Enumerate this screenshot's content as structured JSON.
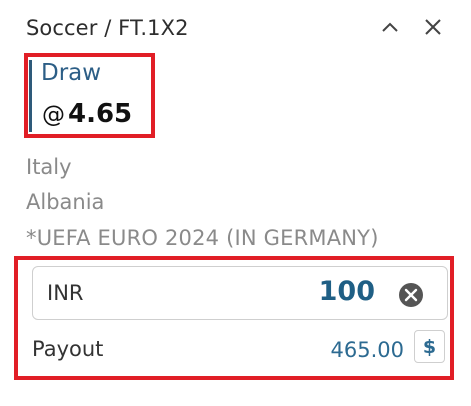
{
  "header": {
    "title": "Soccer / FT.1X2"
  },
  "selection": {
    "name": "Draw",
    "at_symbol": "@",
    "odds": "4.65"
  },
  "match": {
    "team1": "Italy",
    "team2": "Albania",
    "competition": "*UEFA EURO 2024 (IN GERMANY)"
  },
  "stake": {
    "currency": "INR",
    "value": "100"
  },
  "payout": {
    "label": "Payout",
    "value": "465.00",
    "currency_symbol": "$"
  },
  "icons": {
    "collapse": "chevron-up-icon",
    "close": "close-icon",
    "clear": "clear-circle-icon"
  },
  "colors": {
    "highlight_border": "#e11e26",
    "accent_blue": "#2c5e86",
    "stake_value": "#1f5f85"
  }
}
